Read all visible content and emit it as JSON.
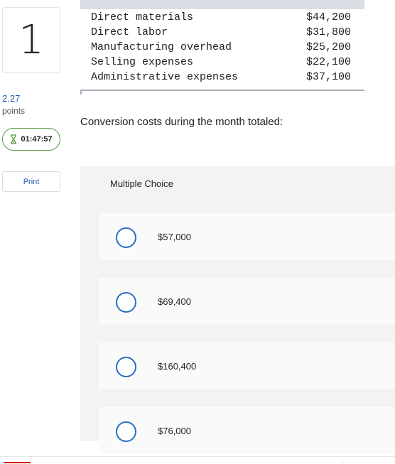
{
  "question": {
    "number": "1",
    "points_value": "2.27",
    "points_label": "points",
    "timer": "01:47:57",
    "print_label": "Print",
    "prompt": "Conversion costs during the month totaled:"
  },
  "cost_table": {
    "rows": [
      {
        "label": "Direct materials",
        "amount": "$44,200"
      },
      {
        "label": "Direct labor",
        "amount": "$31,800"
      },
      {
        "label": "Manufacturing overhead",
        "amount": "$25,200"
      },
      {
        "label": "Selling expenses",
        "amount": "$22,100"
      },
      {
        "label": "Administrative expenses",
        "amount": "$37,100"
      }
    ]
  },
  "multiple_choice": {
    "title": "Multiple Choice",
    "options": [
      "$57,000",
      "$69,400",
      "$160,400",
      "$76,000"
    ]
  },
  "colors": {
    "accent_blue": "#1e5aa8",
    "timer_green": "#4f9a3f",
    "radio_blue": "#2a6fc4",
    "footer_red": "#d0021b"
  }
}
